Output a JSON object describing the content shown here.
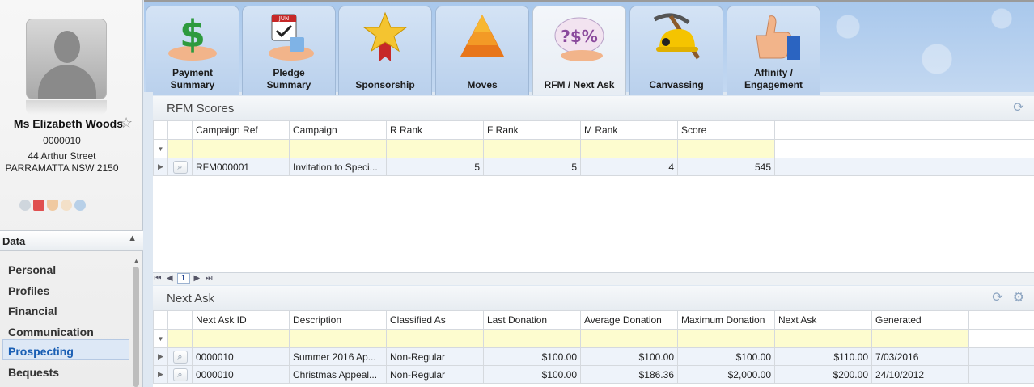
{
  "donor": {
    "name": "Ms Elizabeth Woods",
    "id": "0000010",
    "address_line1": "44 Arthur Street",
    "address_line2": "PARRAMATTA NSW 2150"
  },
  "sidebar": {
    "section_title": "Data",
    "items": [
      {
        "label": "Personal"
      },
      {
        "label": "Profiles"
      },
      {
        "label": "Financial"
      },
      {
        "label": "Communication"
      },
      {
        "label": "Prospecting"
      },
      {
        "label": "Bequests"
      }
    ],
    "active_item": "Prospecting"
  },
  "tabs": [
    {
      "label": "Payment Summary",
      "icon": "money-hand-icon"
    },
    {
      "label": "Pledge Summary",
      "icon": "calendar-hand-icon"
    },
    {
      "label": "Sponsorship",
      "icon": "star-ribbon-icon"
    },
    {
      "label": "Moves",
      "icon": "pyramid-icon"
    },
    {
      "label": "RFM / Next Ask",
      "icon": "question-dollar-percent-icon"
    },
    {
      "label": "Canvassing",
      "icon": "pickaxe-hardhat-icon"
    },
    {
      "label": "Affinity / Engagement",
      "icon": "thumbs-up-icon"
    }
  ],
  "active_tab": "RFM / Next Ask",
  "rfm": {
    "title": "RFM Scores",
    "columns": [
      "Campaign Ref",
      "Campaign",
      "R Rank",
      "F Rank",
      "M Rank",
      "Score"
    ],
    "rows": [
      [
        "RFM000001",
        "Invitation to Speci...",
        "5",
        "5",
        "4",
        "545"
      ]
    ],
    "pager": {
      "page": "1"
    }
  },
  "next_ask": {
    "title": "Next Ask",
    "columns": [
      "Next Ask ID",
      "Description",
      "Classified As",
      "Last Donation",
      "Average Donation",
      "Maximum Donation",
      "Next Ask",
      "Generated"
    ],
    "rows": [
      [
        "0000010",
        "Summer 2016 Ap...",
        "Non-Regular",
        "$100.00",
        "$100.00",
        "$100.00",
        "$110.00",
        "7/03/2016"
      ],
      [
        "0000010",
        "Christmas Appeal...",
        "Non-Regular",
        "$100.00",
        "$186.36",
        "$2,000.00",
        "$200.00",
        "24/10/2012"
      ]
    ]
  }
}
